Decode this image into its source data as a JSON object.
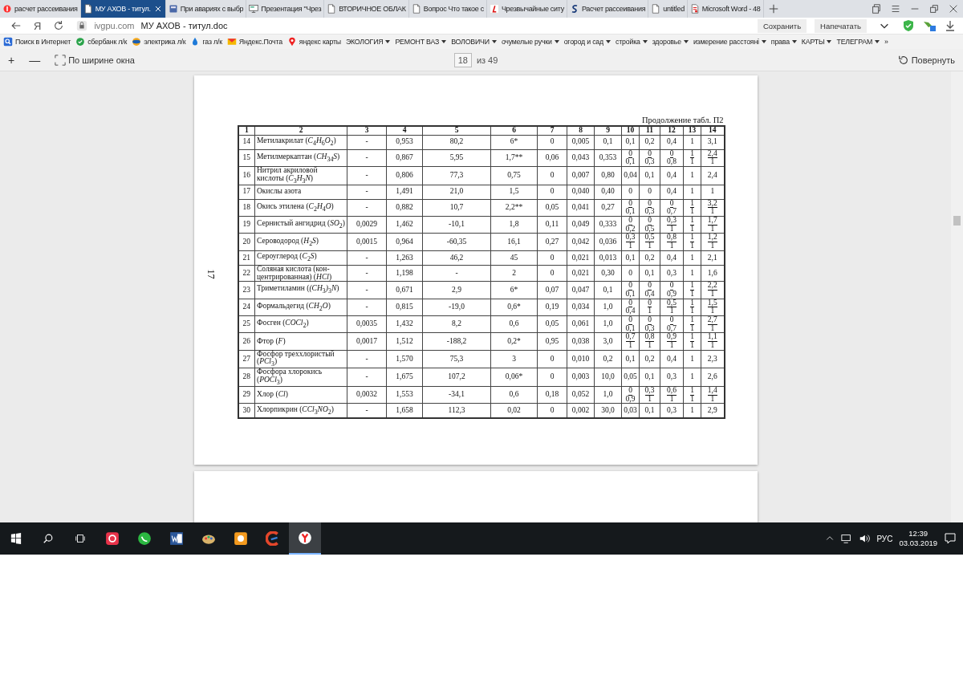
{
  "tabs": [
    {
      "label": "расчет рассеивания",
      "kind": "yandex",
      "selected": false
    },
    {
      "label": "МУ АХОВ - титул.",
      "kind": "doc",
      "selected": true
    },
    {
      "label": "При авариях с выбр",
      "kind": "book",
      "selected": false
    },
    {
      "label": "Презентация \"Чрез",
      "kind": "slides",
      "selected": false
    },
    {
      "label": "ВТОРИЧНОЕ ОБЛАК",
      "kind": "doc",
      "selected": false
    },
    {
      "label": "Вопрос Что такое с",
      "kind": "doc",
      "selected": false
    },
    {
      "label": "Чрезвычайные ситу",
      "kind": "red-mark",
      "selected": false
    },
    {
      "label": "Расчет рассеивания",
      "kind": "blue-mark",
      "selected": false
    },
    {
      "label": "untitled",
      "kind": "doc",
      "selected": false
    },
    {
      "label": "Microsoft Word - 48",
      "kind": "word",
      "selected": false
    }
  ],
  "address_bar": {
    "logo": "Я",
    "host": "ivgpu.com",
    "title": "МУ АХОВ - титул.doc",
    "buttons": [
      "Сохранить",
      "Напечатать"
    ]
  },
  "bookmarks": [
    {
      "label": "Поиск в Интернет",
      "kind": "search"
    },
    {
      "label": "сбербанк л/к",
      "kind": "bank"
    },
    {
      "label": "электрика л/к",
      "kind": "globe"
    },
    {
      "label": "газ л/к",
      "kind": "flame"
    },
    {
      "label": "Яндекс.Почта",
      "kind": "mail"
    },
    {
      "label": "яндекс карты",
      "kind": "pin"
    },
    {
      "label": "ЭКОЛОГИЯ",
      "kind": "folder"
    },
    {
      "label": "РЕМОНТ ВАЗ",
      "kind": "folder"
    },
    {
      "label": "ВОЛОВИЧИ",
      "kind": "folder"
    },
    {
      "label": "очумелые ручки",
      "kind": "folder"
    },
    {
      "label": "огород и сад",
      "kind": "folder"
    },
    {
      "label": "стройка",
      "kind": "folder"
    },
    {
      "label": "здоровье",
      "kind": "folder"
    },
    {
      "label": "измерение расстояні",
      "kind": "folder"
    },
    {
      "label": "права",
      "kind": "folder"
    },
    {
      "label": "КАРТЫ",
      "kind": "folder"
    },
    {
      "label": "ТЕЛЕГРАМ",
      "kind": "folder"
    },
    {
      "label": "»",
      "kind": "more"
    }
  ],
  "viewer_toolbar": {
    "zoom_in": "+",
    "zoom_out": "—",
    "fit": "По ширине окна",
    "page": "18",
    "page_count": "из 49",
    "rotate": "Повернуть"
  },
  "document": {
    "page_number": "17",
    "caption": "Продолжение табл. П2",
    "columns": [
      "1",
      "2",
      "3",
      "4",
      "5",
      "6",
      "7",
      "8",
      "9",
      "10",
      "11",
      "12",
      "13",
      "14"
    ],
    "rows": [
      [
        "14",
        "Метилакрилат (*C*$_{4}$*H*$_{6}$*O*$_{2}$)",
        "-",
        "0,953",
        "80,2",
        "6*",
        "0",
        "0,005",
        "0,1",
        "0,1",
        "0,2",
        "0,4",
        "1",
        "3,1"
      ],
      [
        "15",
        "Метилмеркаптан (*CH*$_{34}$*S*)",
        "-",
        "0,867",
        "5,95",
        "1,7**",
        "0,06",
        "0,043",
        "0,353",
        {
          "num": "0",
          "den": "0,1"
        },
        {
          "num": "0",
          "den": "0,3"
        },
        {
          "num": "0",
          "den": "0,8"
        },
        {
          "num": "1",
          "den": "1"
        },
        {
          "num": "2,4",
          "den": "1"
        }
      ],
      [
        "16",
        "Нитрил акриловой кислоты (*C*$_{3}$*H*$_{3}$*N*)",
        "-",
        "0,806",
        "77,3",
        "0,75",
        "0",
        "0,007",
        "0,80",
        "0,04",
        "0,1",
        "0,4",
        "1",
        "2,4"
      ],
      [
        "17",
        "Окислы азота",
        "-",
        "1,491",
        "21,0",
        "1,5",
        "0",
        "0,040",
        "0,40",
        "0",
        "0",
        "0,4",
        "1",
        "1"
      ],
      [
        "18",
        "Окись этилена (*C*$_{2}$*H*$_{4}$*O*)",
        "-",
        "0,882",
        "10,7",
        "2,2**",
        "0,05",
        "0,041",
        "0,27",
        {
          "num": "0",
          "den": "0,1"
        },
        {
          "num": "0",
          "den": "0,3"
        },
        {
          "num": "0",
          "den": "0,7"
        },
        {
          "num": "1",
          "den": "1"
        },
        {
          "num": "3,2",
          "den": "1"
        }
      ],
      [
        "19",
        "Сернистый ангидрид (*SO*$_{2}$)",
        "0,0029",
        "1,462",
        "-10,1",
        "1,8",
        "0,11",
        "0,049",
        "0,333",
        {
          "num": "0",
          "den": "0,2"
        },
        {
          "num": "0",
          "den": "0,5"
        },
        {
          "num": "0,3",
          "den": "1"
        },
        {
          "num": "1",
          "den": "1"
        },
        {
          "num": "1,7",
          "den": "1"
        }
      ],
      [
        "20",
        "Сероводород (*H*$_{2}$*S*)",
        "0,0015",
        "0,964",
        "-60,35",
        "16,1",
        "0,27",
        "0,042",
        "0,036",
        {
          "num": "0,3",
          "den": "1"
        },
        {
          "num": "0,5",
          "den": "1"
        },
        {
          "num": "0,8",
          "den": "1"
        },
        {
          "num": "1",
          "den": "1"
        },
        {
          "num": "1,2",
          "den": "1"
        }
      ],
      [
        "21",
        "Сероуглерод (*C*$_{2}$*S*)",
        "-",
        "1,263",
        "46,2",
        "45",
        "0",
        "0,021",
        "0,013",
        "0,1",
        "0,2",
        "0,4",
        "1",
        "2,1"
      ],
      [
        "22",
        "Соляная кислота (кон-центрированная) (*HCl*)",
        "-",
        "1,198",
        "-",
        "2",
        "0",
        "0,021",
        "0,30",
        "0",
        "0,1",
        "0,3",
        "1",
        "1,6"
      ],
      [
        "23",
        "Триметиламин (*(CH*$_{3}$*)*$_{3}$*N*)",
        "-",
        "0,671",
        "2,9",
        "6*",
        "0,07",
        "0,047",
        "0,1",
        {
          "num": "0",
          "den": "0,1"
        },
        {
          "num": "0",
          "den": "0,4"
        },
        {
          "num": "0",
          "den": "0,9"
        },
        {
          "num": "1",
          "den": "1"
        },
        {
          "num": "2,2",
          "den": "1"
        }
      ],
      [
        "24",
        "Формальдегид (*CH*$_{2}$*O*)",
        "-",
        "0,815",
        "-19,0",
        "0,6*",
        "0,19",
        "0,034",
        "1,0",
        {
          "num": "0",
          "den": "0,4"
        },
        {
          "num": "0",
          "den": "1"
        },
        {
          "num": "0,5",
          "den": "1"
        },
        {
          "num": "1",
          "den": "1"
        },
        {
          "num": "1,5",
          "den": "1"
        }
      ],
      [
        "25",
        "Фосген (*COCl*$_{2}$)",
        "0,0035",
        "1,432",
        "8,2",
        "0,6",
        "0,05",
        "0,061",
        "1,0",
        {
          "num": "0",
          "den": "0,1"
        },
        {
          "num": "0",
          "den": "0,3"
        },
        {
          "num": "0",
          "den": "0,7"
        },
        {
          "num": "1",
          "den": "1"
        },
        {
          "num": "2,7",
          "den": "1"
        }
      ],
      [
        "26",
        "Фтор (*F*)",
        "0,0017",
        "1,512",
        "-188,2",
        "0,2*",
        "0,95",
        "0,038",
        "3,0",
        {
          "num": "0,7",
          "den": "1"
        },
        {
          "num": "0,8",
          "den": "1"
        },
        {
          "num": "0,9",
          "den": "1"
        },
        {
          "num": "1",
          "den": "1"
        },
        {
          "num": "1,1",
          "den": "1"
        }
      ],
      [
        "27",
        "Фосфор треххлористый (*PCl*$_{3}$)",
        "-",
        "1,570",
        "75,3",
        "3",
        "0",
        "0,010",
        "0,2",
        "0,1",
        "0,2",
        "0,4",
        "1",
        "2,3"
      ],
      [
        "28",
        "Фосфора хлорокись (*POCl*$_{3}$)",
        "-",
        "1,675",
        "107,2",
        "0,06*",
        "0",
        "0,003",
        "10,0",
        "0,05",
        "0,1",
        "0,3",
        "1",
        "2,6"
      ],
      [
        "29",
        "Хлор (*Cl*)",
        "0,0032",
        "1,553",
        "-34,1",
        "0,6",
        "0,18",
        "0,052",
        "1,0",
        {
          "num": "0",
          "den": "0,9"
        },
        {
          "num": "0,3",
          "den": "1"
        },
        {
          "num": "0,6",
          "den": "1"
        },
        {
          "num": "1",
          "den": "1"
        },
        {
          "num": "1,4",
          "den": "1"
        }
      ],
      [
        "30",
        "Хлорпикрин (*CCl*$_{3}$*NO*$_{2}$)",
        "-",
        "1,658",
        "112,3",
        "0,02",
        "0",
        "0,002",
        "30,0",
        "0,03",
        "0,1",
        "0,3",
        "1",
        "2,9"
      ]
    ]
  },
  "taskbar": {
    "apps": [
      {
        "kind": "red-app",
        "selected": false
      },
      {
        "kind": "chat",
        "selected": false
      },
      {
        "kind": "word",
        "selected": false
      },
      {
        "kind": "paint",
        "selected": false
      },
      {
        "kind": "orange",
        "selected": false
      },
      {
        "kind": "cleaner",
        "selected": false
      },
      {
        "kind": "yandex",
        "selected": true
      }
    ],
    "language": "РУС",
    "time": "12:39",
    "date": "03.03.2019"
  }
}
